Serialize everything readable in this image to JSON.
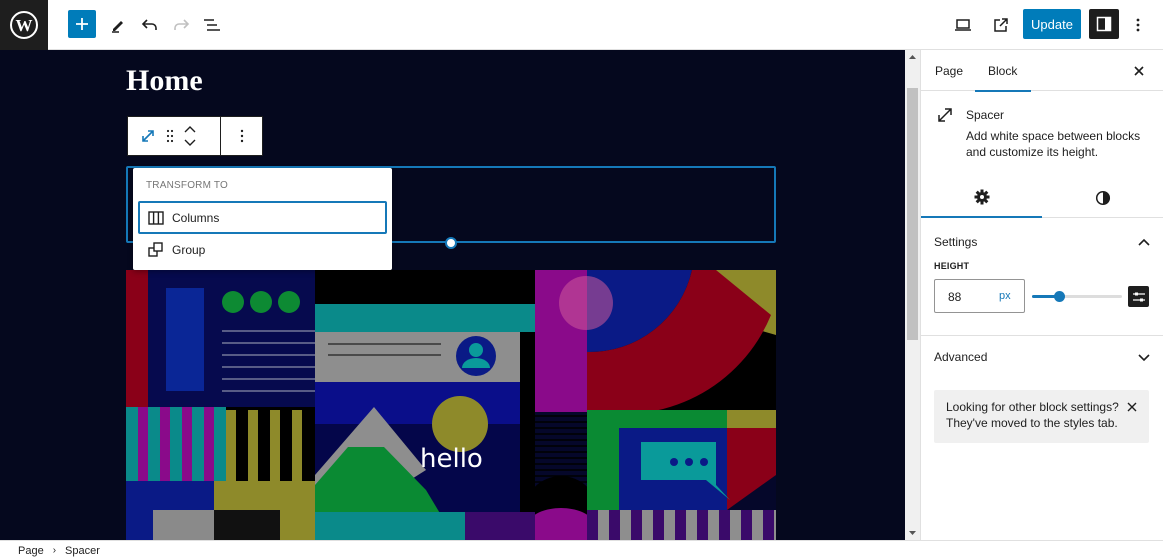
{
  "topbar": {
    "logo": "wordpress-logo",
    "add_block_label": "+",
    "update_label": "Update",
    "icons": [
      "plus-icon",
      "pencil-icon",
      "undo-icon",
      "redo-icon",
      "list-view-icon",
      "desktop-icon",
      "external-link-icon",
      "sidebar-icon",
      "more-vertical-icon"
    ]
  },
  "canvas": {
    "page_title": "Home",
    "block_toolbar": {
      "icons": [
        "spacer-resize-icon",
        "drag-handle-icon",
        "move-up-icon",
        "move-down-icon",
        "more-options-icon"
      ]
    },
    "transform_menu": {
      "heading": "TRANSFORM TO",
      "items": [
        {
          "label": "Columns",
          "icon": "columns-icon",
          "active": true
        },
        {
          "label": "Group",
          "icon": "group-icon",
          "active": false
        }
      ]
    },
    "image_text": "hello"
  },
  "sidebar": {
    "tabs": [
      {
        "label": "Page",
        "active": false
      },
      {
        "label": "Block",
        "active": true
      }
    ],
    "block": {
      "name": "Spacer",
      "description": "Add white space between blocks and customize its height."
    },
    "subtabs": [
      "settings-gear-icon",
      "styles-contrast-icon"
    ],
    "settings_panel": {
      "title": "Settings",
      "height_label": "HEIGHT",
      "height_value": "88",
      "height_unit": "px",
      "slider_fraction": 0.3
    },
    "advanced_panel": {
      "title": "Advanced"
    },
    "notice": "Looking for other block settings? They've moved to the styles tab."
  },
  "breadcrumb": [
    "Page",
    "Spacer"
  ],
  "colors": {
    "accent": "#007cba",
    "canvas_bg": "#05081e",
    "selection": "#1578b8"
  }
}
